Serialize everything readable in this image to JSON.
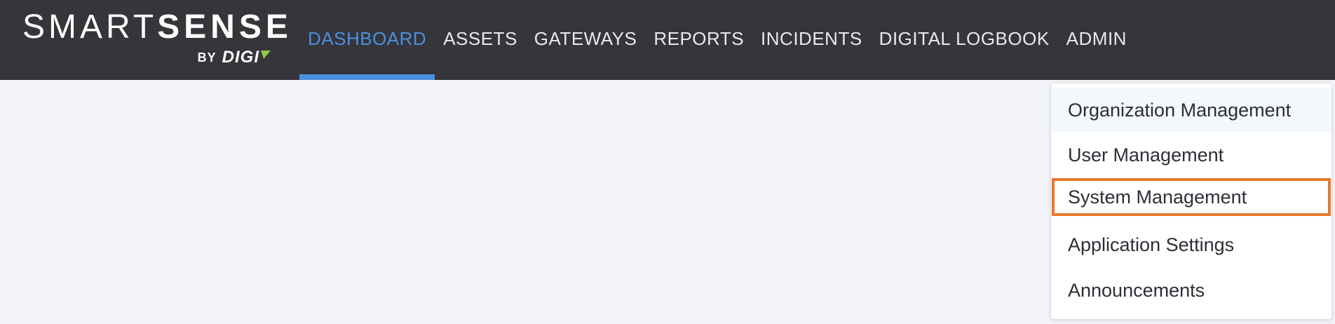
{
  "brand": {
    "word1": "SMART",
    "word2": "SENSE",
    "by": "BY",
    "digi": "DIGI",
    "accent_color": "#8cc84b"
  },
  "nav": {
    "items": [
      {
        "label": "DASHBOARD",
        "active": true
      },
      {
        "label": "ASSETS"
      },
      {
        "label": "GATEWAYS"
      },
      {
        "label": "REPORTS"
      },
      {
        "label": "INCIDENTS"
      },
      {
        "label": "DIGITAL LOGBOOK"
      },
      {
        "label": "ADMIN"
      }
    ],
    "active_color": "#4a90df"
  },
  "admin_menu": {
    "items": [
      {
        "label": "Organization Management"
      },
      {
        "label": "User Management"
      },
      {
        "label": "System Management"
      },
      {
        "label": "Application Settings"
      },
      {
        "label": "Announcements"
      }
    ],
    "highlight_color": "#e8782a"
  }
}
